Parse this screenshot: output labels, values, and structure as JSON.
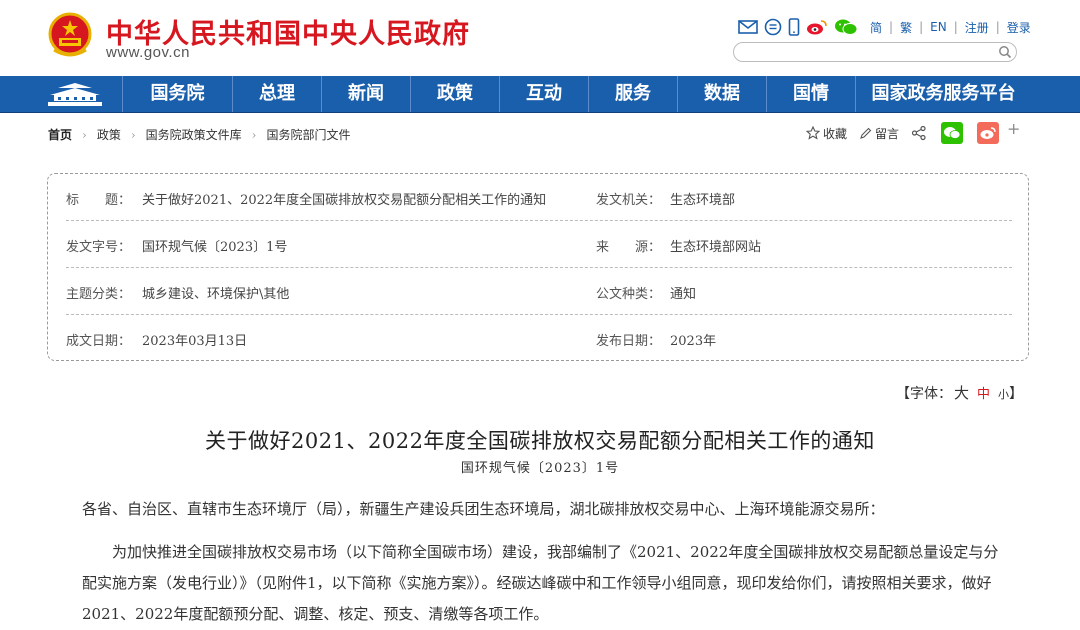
{
  "header": {
    "site_title": "中华人民共和国中央人民政府",
    "site_domain": "www.gov.cn",
    "links": [
      "简",
      "繁",
      "EN",
      "注册",
      "登录"
    ],
    "search_placeholder": ""
  },
  "nav": {
    "items": [
      "国务院",
      "总理",
      "新闻",
      "政策",
      "互动",
      "服务",
      "数据",
      "国情",
      "国家政务服务平台"
    ]
  },
  "breadcrumb": {
    "items": [
      "首页",
      "政策",
      "国务院政策文件库",
      "国务院部门文件"
    ]
  },
  "actions": {
    "favorite": "收藏",
    "comment": "留言",
    "plus": "+"
  },
  "info": {
    "rows": [
      {
        "k1": "标　　题：",
        "v1": "关于做好2021、2022年度全国碳排放权交易配额分配相关工作的通知",
        "k2": "发文机关：",
        "v2": "生态环境部"
      },
      {
        "k1": "发文字号：",
        "v1": "国环规气候〔2023〕1号",
        "k2": "来　　源：",
        "v2": "生态环境部网站"
      },
      {
        "k1": "主题分类：",
        "v1": "城乡建设、环境保护\\其他",
        "k2": "公文种类：",
        "v2": "通知"
      },
      {
        "k1": "成文日期：",
        "v1": "2023年03月13日",
        "k2": "发布日期：",
        "v2": "2023年"
      }
    ]
  },
  "font_control": {
    "label": "【字体：",
    "big": "大",
    "mid": "中",
    "small": "小",
    "end": "】"
  },
  "article": {
    "title": "关于做好2021、2022年度全国碳排放权交易配额分配相关工作的通知",
    "doc_number": "国环规气候〔2023〕1号",
    "p1": "各省、自治区、直辖市生态环境厅（局），新疆生产建设兵团生态环境局，湖北碳排放权交易中心、上海环境能源交易所：",
    "p2": "为加快推进全国碳排放权交易市场（以下简称全国碳市场）建设，我部编制了《2021、2022年度全国碳排放权交易配额总量设定与分配实施方案（发电行业）》（见附件1，以下简称《实施方案》）。经碳达峰碳中和工作领导小组同意，现印发给你们，请按照相关要求，做好2021、2022年度配额预分配、调整、核定、预支、清缴等各项工作。"
  },
  "colors": {
    "brand_red": "#d7171f",
    "nav_blue": "#1a5fab",
    "wechat_green": "#2dc100",
    "weibo_orange": "#f26b5b"
  }
}
